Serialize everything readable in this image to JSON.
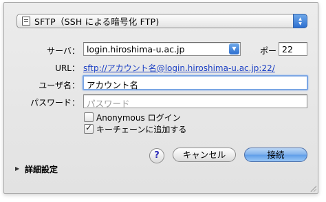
{
  "protocol": {
    "label": "SFTP（SSH による暗号化 FTP)",
    "icon": "file-icon"
  },
  "server": {
    "label": "サーバ：",
    "value": "login.hiroshima-u.ac.jp"
  },
  "port": {
    "label": "ポー",
    "value": "22"
  },
  "url": {
    "label": "URL：",
    "value": "sftp://アカウント名@login.hiroshima-u.ac.jp:22/"
  },
  "username": {
    "label": "ユーザ名：",
    "value": "アカウント名"
  },
  "password": {
    "label": "パスワード：",
    "placeholder": "パスワード"
  },
  "options": {
    "anonymous": "Anonymous ログイン",
    "keychain": "キーチェーンに追加する"
  },
  "buttons": {
    "help": "?",
    "cancel": "キャンセル",
    "connect": "接続"
  },
  "advanced": {
    "label": "詳細設定"
  }
}
